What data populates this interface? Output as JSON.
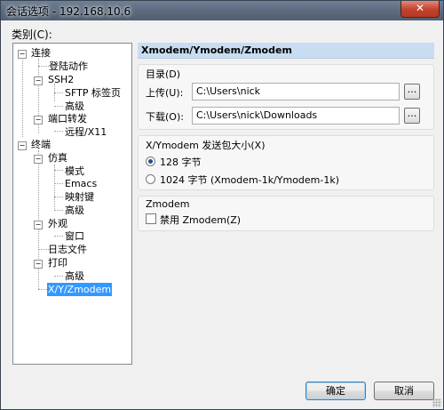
{
  "window": {
    "title": "会话选项 - 192.168.10.6",
    "close_glyph": "✕"
  },
  "category_label": "类别(C):",
  "tree": {
    "connection": "连接",
    "login_actions": "登陆动作",
    "ssh2": "SSH2",
    "sftp_tab": "SFTP 标签页",
    "advanced_1": "高级",
    "port_forwarding": "端口转发",
    "remote_x11": "远程/X11",
    "terminal": "终端",
    "emulation": "仿真",
    "modes": "模式",
    "emacs": "Emacs",
    "mapped_keys": "映射键",
    "advanced_2": "高级",
    "appearance": "外观",
    "window_item": "窗口",
    "log_file": "日志文件",
    "printing": "打印",
    "advanced_3": "高级",
    "xyzmodem": "X/Y/Zmodem",
    "expanded_glyph": "−"
  },
  "panel": {
    "header": "Xmodem/Ymodem/Zmodem",
    "directories": {
      "title": "目录(D)",
      "upload_label": "上传(U):",
      "upload_value": "C:\\Users\\nick",
      "download_label": "下载(O):",
      "download_value": "C:\\Users\\nick\\Downloads",
      "browse_label": "..."
    },
    "packet_size": {
      "title": "X/Ymodem 发送包大小(X)",
      "option_128": "128 字节",
      "option_1024": "1024 字节 (Xmodem-1k/Ymodem-1k)",
      "selected": "128"
    },
    "zmodem": {
      "title": "Zmodem",
      "disable_label": "禁用 Zmodem(Z)",
      "disabled": false
    }
  },
  "buttons": {
    "ok": "确定",
    "cancel": "取消"
  }
}
